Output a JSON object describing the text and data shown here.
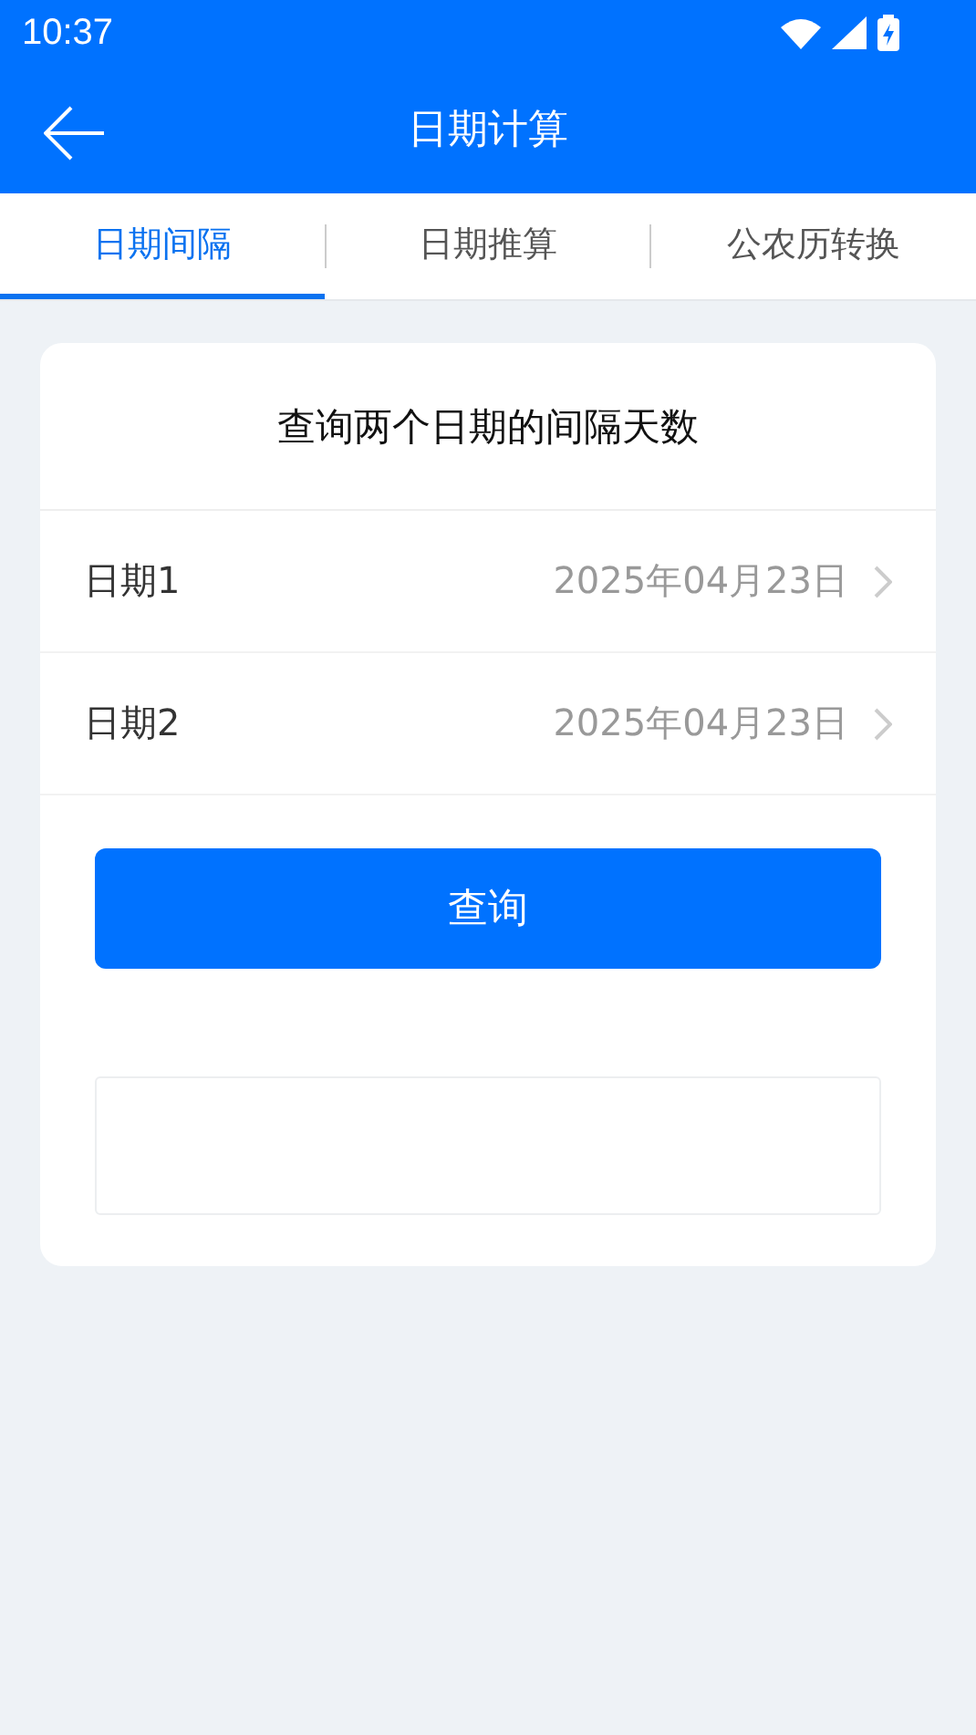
{
  "status_bar": {
    "time": "10:37"
  },
  "app_bar": {
    "title": "日期计算"
  },
  "tabs": [
    {
      "label": "日期间隔",
      "selected": true
    },
    {
      "label": "日期推算",
      "selected": false
    },
    {
      "label": "公农历转换",
      "selected": false
    }
  ],
  "card": {
    "heading": "查询两个日期的间隔天数",
    "rows": [
      {
        "label": "日期1",
        "value": "2025年04月23日"
      },
      {
        "label": "日期2",
        "value": "2025年04月23日"
      }
    ],
    "button": "查询"
  }
}
